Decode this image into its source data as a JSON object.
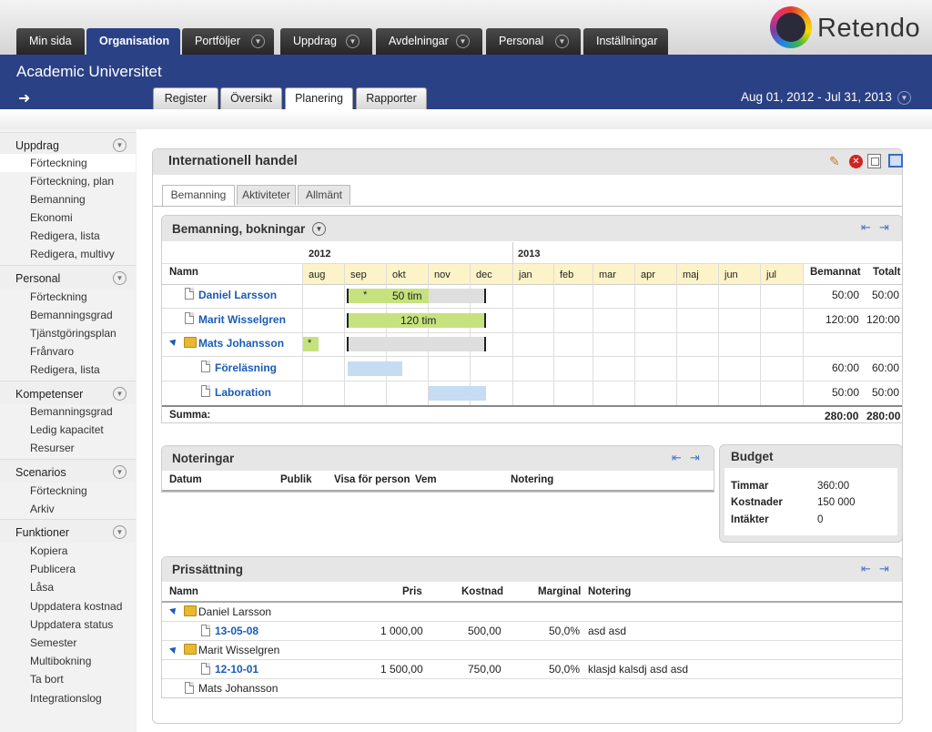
{
  "top_tabs": [
    {
      "label": "Min sida",
      "dropdown": false
    },
    {
      "label": "Organisation",
      "dropdown": false
    },
    {
      "label": "Portföljer",
      "dropdown": true
    },
    {
      "label": "Uppdrag",
      "dropdown": true
    },
    {
      "label": "Avdelningar",
      "dropdown": true
    },
    {
      "label": "Personal",
      "dropdown": true
    },
    {
      "label": "Inställningar",
      "dropdown": false
    }
  ],
  "brand": "Retendo",
  "org_name": "Academic Universitet",
  "sub_tabs": [
    "Register",
    "Översikt",
    "Planering",
    "Rapporter"
  ],
  "date_range": "Aug 01, 2012 - Jul 31, 2013",
  "sidebar": {
    "sections": [
      {
        "title": "Uppdrag",
        "items": [
          "Förteckning",
          "Förteckning, plan",
          "Bemanning",
          "Ekonomi",
          "Redigera, lista",
          "Redigera, multivy"
        ]
      },
      {
        "title": "Personal",
        "items": [
          "Förteckning",
          "Bemanningsgrad",
          "Tjänstgöringsplan",
          "Frånvaro",
          "Redigera, lista"
        ]
      },
      {
        "title": "Kompetenser",
        "items": [
          "Bemanningsgrad",
          "Ledig kapacitet",
          "Resurser"
        ]
      },
      {
        "title": "Scenarios",
        "items": [
          "Förteckning",
          "Arkiv"
        ]
      },
      {
        "title": "Funktioner",
        "items": [
          "Kopiera",
          "Publicera",
          "Låsa",
          "Uppdatera kostnad",
          "Uppdatera status",
          "Semester",
          "Multibokning",
          "Ta bort",
          "Integrationslog"
        ]
      }
    ]
  },
  "page_title": "Internationell handel",
  "inner_tabs": [
    "Bemanning",
    "Aktiviteter",
    "Allmänt"
  ],
  "bemanning": {
    "title": "Bemanning, bokningar",
    "years": [
      "2012",
      "2013"
    ],
    "col_namn": "Namn",
    "months": [
      "aug",
      "sep",
      "okt",
      "nov",
      "dec",
      "jan",
      "feb",
      "mar",
      "apr",
      "maj",
      "jun",
      "jul"
    ],
    "col_bemannat": "Bemannat",
    "col_totalt": "Totalt",
    "rows": [
      {
        "name": "Daniel Larsson",
        "bar_label": "50 tim",
        "star": "*",
        "bemannat": "50:00",
        "totalt": "50:00"
      },
      {
        "name": "Marit Wisselgren",
        "bar_label": "120 tim",
        "bemannat": "120:00",
        "totalt": "120:00"
      },
      {
        "name": "Mats Johansson",
        "star": "*",
        "bemannat": "",
        "totalt": ""
      },
      {
        "name": "Föreläsning",
        "bemannat": "60:00",
        "totalt": "60:00"
      },
      {
        "name": "Laboration",
        "bemannat": "50:00",
        "totalt": "50:00"
      }
    ],
    "summa_label": "Summa:",
    "summa_bemannat": "280:00",
    "summa_totalt": "280:00"
  },
  "noteringar": {
    "title": "Noteringar",
    "cols": [
      "Datum",
      "Publik",
      "Visa för person",
      "Vem",
      "Notering"
    ]
  },
  "budget": {
    "title": "Budget",
    "rows": [
      {
        "label": "Timmar",
        "value": "360:00"
      },
      {
        "label": "Kostnader",
        "value": "150 000"
      },
      {
        "label": "Intäkter",
        "value": "0"
      }
    ]
  },
  "prissattning": {
    "title": "Prissättning",
    "cols": [
      "Namn",
      "Pris",
      "Kostnad",
      "Marginal",
      "Notering"
    ],
    "rows": [
      {
        "type": "person",
        "name": "Daniel Larsson"
      },
      {
        "type": "item",
        "name": "13-05-08",
        "pris": "1 000,00",
        "kostnad": "500,00",
        "marginal": "50,0%",
        "notering": "asd asd"
      },
      {
        "type": "person",
        "name": "Marit Wisselgren"
      },
      {
        "type": "item",
        "name": "12-10-01",
        "pris": "1 500,00",
        "kostnad": "750,00",
        "marginal": "50,0%",
        "notering": "klasjd kalsdj asd asd"
      },
      {
        "type": "plain",
        "name": "Mats Johansson"
      }
    ]
  }
}
